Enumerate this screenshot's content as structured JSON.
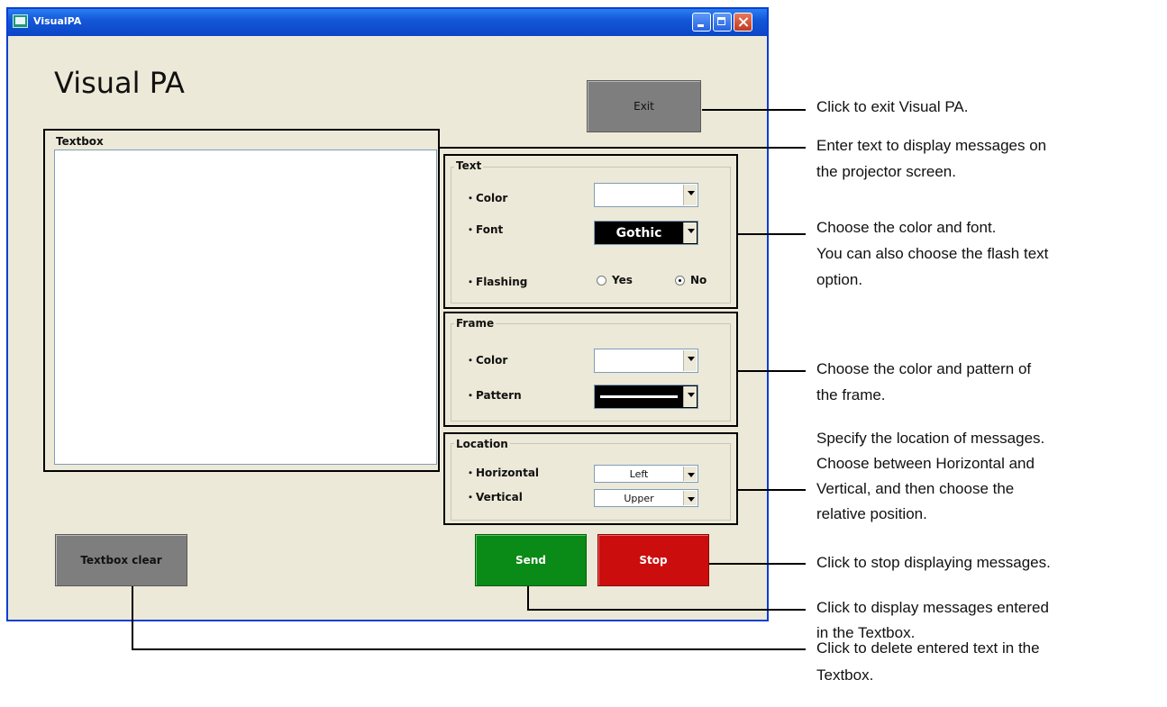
{
  "window": {
    "title": "VisualPA",
    "app_title": "Visual PA"
  },
  "buttons": {
    "exit": "Exit",
    "textbox_clear": "Textbox clear",
    "send": "Send",
    "stop": "Stop"
  },
  "textbox": {
    "label": "Textbox",
    "value": ""
  },
  "text_group": {
    "title": "Text",
    "color_label": "・Color",
    "color_value": "",
    "font_label": "・Font",
    "font_value": "Gothic",
    "flashing_label": "・Flashing",
    "flashing_options": [
      "Yes",
      "No"
    ],
    "flashing_selected": "No"
  },
  "frame_group": {
    "title": "Frame",
    "color_label": "・Color",
    "color_value": "",
    "pattern_label": "・Pattern"
  },
  "location_group": {
    "title": "Location",
    "horizontal_label": "・Horizontal",
    "horizontal_value": "Left",
    "vertical_label": "・Vertical",
    "vertical_value": "Upper"
  },
  "annotations": {
    "exit": "Click to exit Visual PA.",
    "textbox_1": "Enter text to display messages on",
    "textbox_2": "the projector screen.",
    "text_1": "Choose the color and font.",
    "text_2": "You can also choose the flash text",
    "text_3": "option.",
    "frame_1": "Choose the color and pattern of",
    "frame_2": "the frame.",
    "location_1": "Specify the location of messages.",
    "location_2": "Choose between Horizontal and",
    "location_3": "Vertical, and then choose the",
    "location_4": "relative position.",
    "stop": "Click to stop displaying messages.",
    "send_1": "Click to display messages entered",
    "send_2": "in the Textbox.",
    "clear_1": "Click to delete entered text in the",
    "clear_2": "Textbox."
  },
  "colors": {
    "window_bg": "#ece9d8",
    "titlebar": "#0b46c6",
    "send": "#0a8a16",
    "stop": "#cc0d0d",
    "gray_button": "#7e7e7e"
  }
}
